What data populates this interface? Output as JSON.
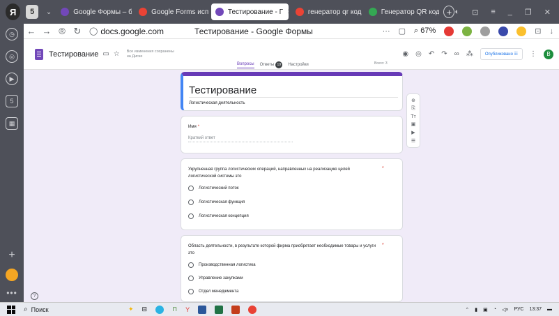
{
  "browser": {
    "tabs": [
      {
        "label": "Google Формы – бе",
        "favicon_color": "#7248b9"
      },
      {
        "label": "Google Forms испо",
        "favicon_color": "#ea4335"
      },
      {
        "label": "Тестирование - Г",
        "favicon_color": "#7248b9",
        "active": true,
        "close": "✕"
      },
      {
        "label": "генератор qr кодо",
        "favicon_color": "#ea4335"
      },
      {
        "label": "Генератор QR кода",
        "favicon_color": "#34a853"
      }
    ],
    "newtab": "+",
    "url": "docs.google.com",
    "page_title": "Тестирование - Google Формы",
    "zoom": "67%",
    "window_controls": [
      "⊡",
      "≡",
      "_",
      "❐",
      "✕"
    ]
  },
  "forms_header": {
    "form_name": "Тестирование",
    "saved_line1": "Все изменения сохранены",
    "saved_line2": "на Диске",
    "publish_label": "Опубликовано",
    "avatar_letter": "B"
  },
  "subtabs": {
    "questions": "Вопросы",
    "answers": "Ответы",
    "answers_count": "19",
    "settings": "Настройки",
    "total": "Всего: 3"
  },
  "title_card": {
    "title": "Тестирование",
    "description": "Логистическая деятельность"
  },
  "questions": [
    {
      "label": "Имя",
      "required": "*",
      "placeholder": "Краткий ответ"
    },
    {
      "label": "Укрупненная группа логистических операций, направленных на реализацию целей логистической системы это",
      "required": "*",
      "options": [
        "Логистический поток",
        "Логистическая функция",
        "Логистическая концепция"
      ]
    },
    {
      "label": "Область деятельности, в результате которой фирма приобретает необходимые товары и услуги это",
      "required": "*",
      "options": [
        "Производственная логистика",
        "Управление закупками",
        "Отдел менеджмента"
      ]
    }
  ],
  "floatbar": [
    "⊕",
    "⎘",
    "Tт",
    "▣",
    "▶",
    "☰"
  ],
  "taskbar": {
    "search_label": "Поиск",
    "lang": "РУС",
    "time": "13:37"
  },
  "colors": {
    "accent": "#673ab7",
    "background": "#f0ebf8",
    "browser_chrome": "#4e5059"
  }
}
